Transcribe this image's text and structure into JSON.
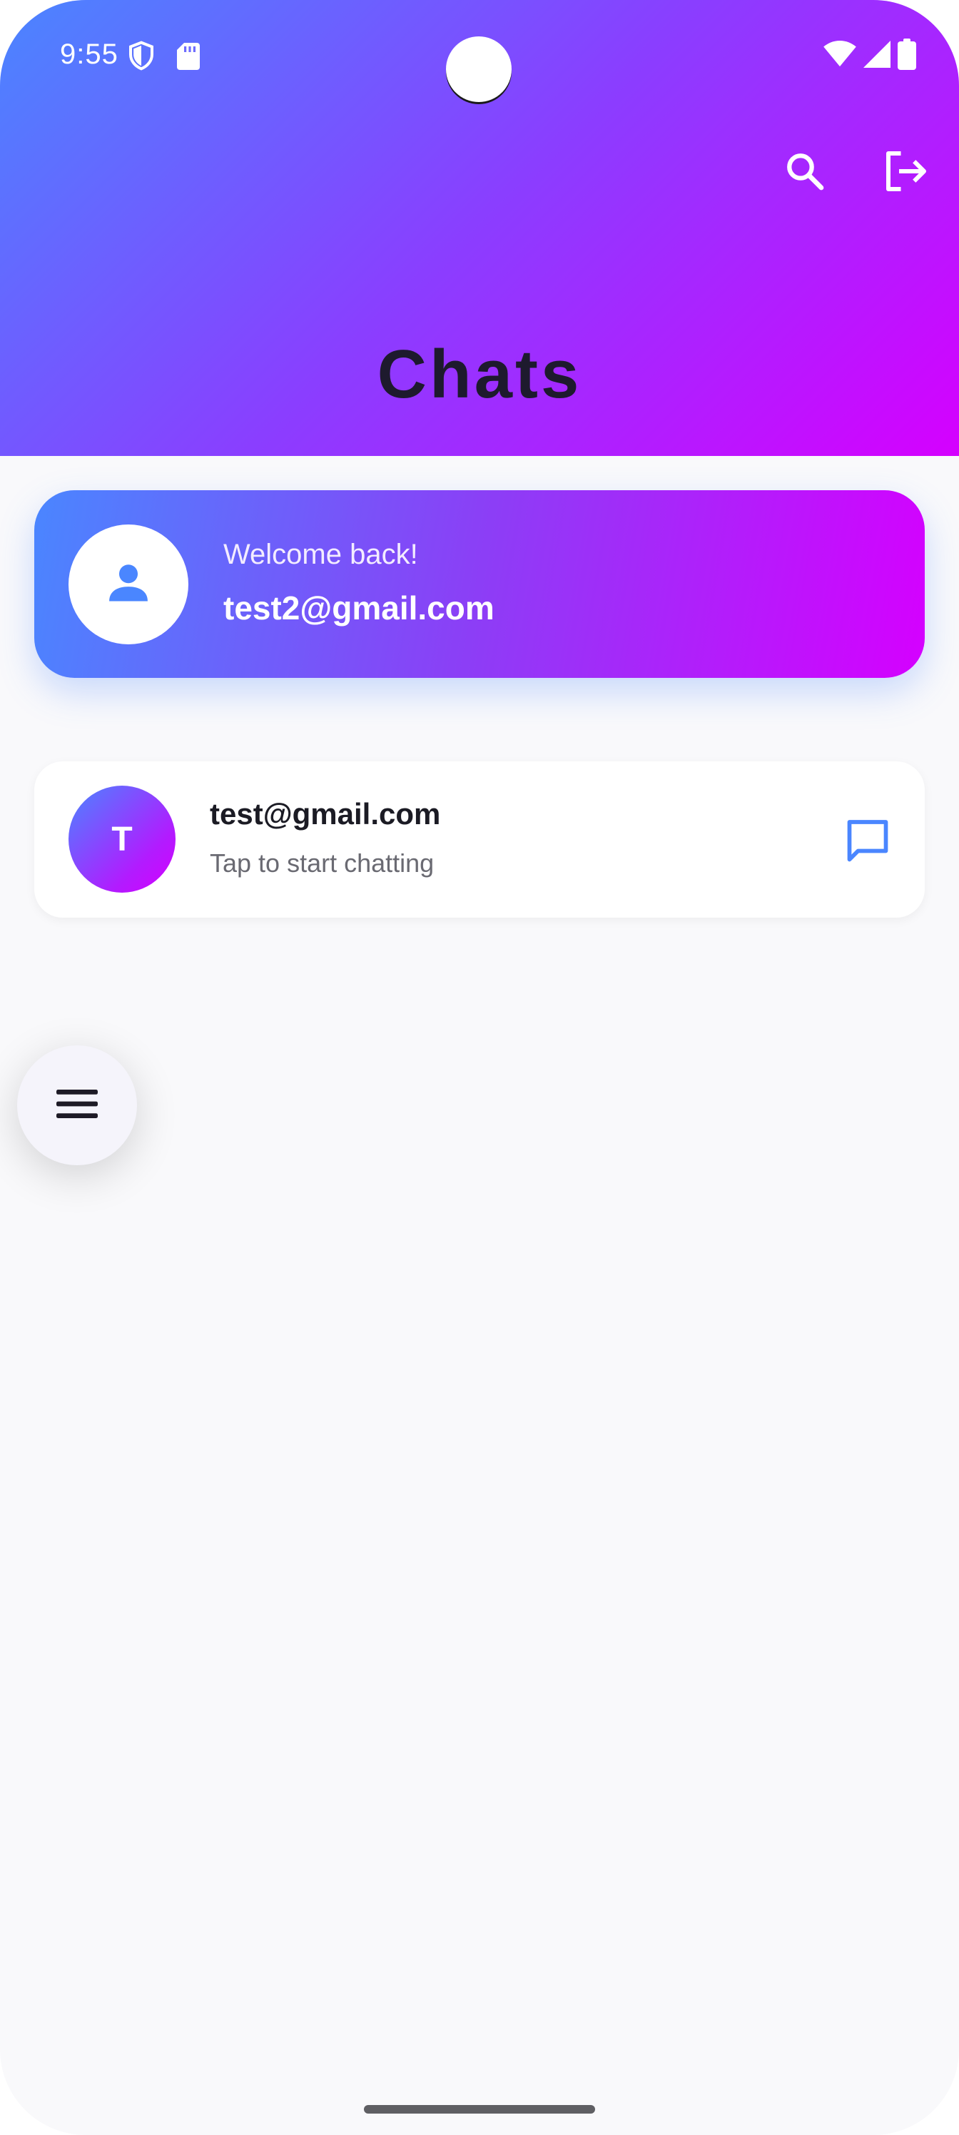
{
  "status_bar": {
    "time": "9:55",
    "left_icons": [
      "shield-icon",
      "sd-card-icon"
    ],
    "right_icons": [
      "wifi-icon",
      "signal-icon",
      "battery-icon"
    ]
  },
  "header": {
    "title": "Chats",
    "actions": [
      "search-icon",
      "logout-icon"
    ],
    "gradient": [
      "#4a86ff",
      "#8b3dff",
      "#d500ff"
    ]
  },
  "welcome_card": {
    "greeting": "Welcome back!",
    "email": "test2@gmail.com",
    "avatar_icon": "person-icon"
  },
  "chats": [
    {
      "initial": "T",
      "name": "test@gmail.com",
      "subtitle": "Tap to start chatting",
      "action_icon": "chat-bubble-icon"
    }
  ],
  "fab": {
    "icon": "menu-icon"
  },
  "colors": {
    "accent": "#4a86ff",
    "accent_end": "#d500ff",
    "background": "#f9f9fb"
  }
}
